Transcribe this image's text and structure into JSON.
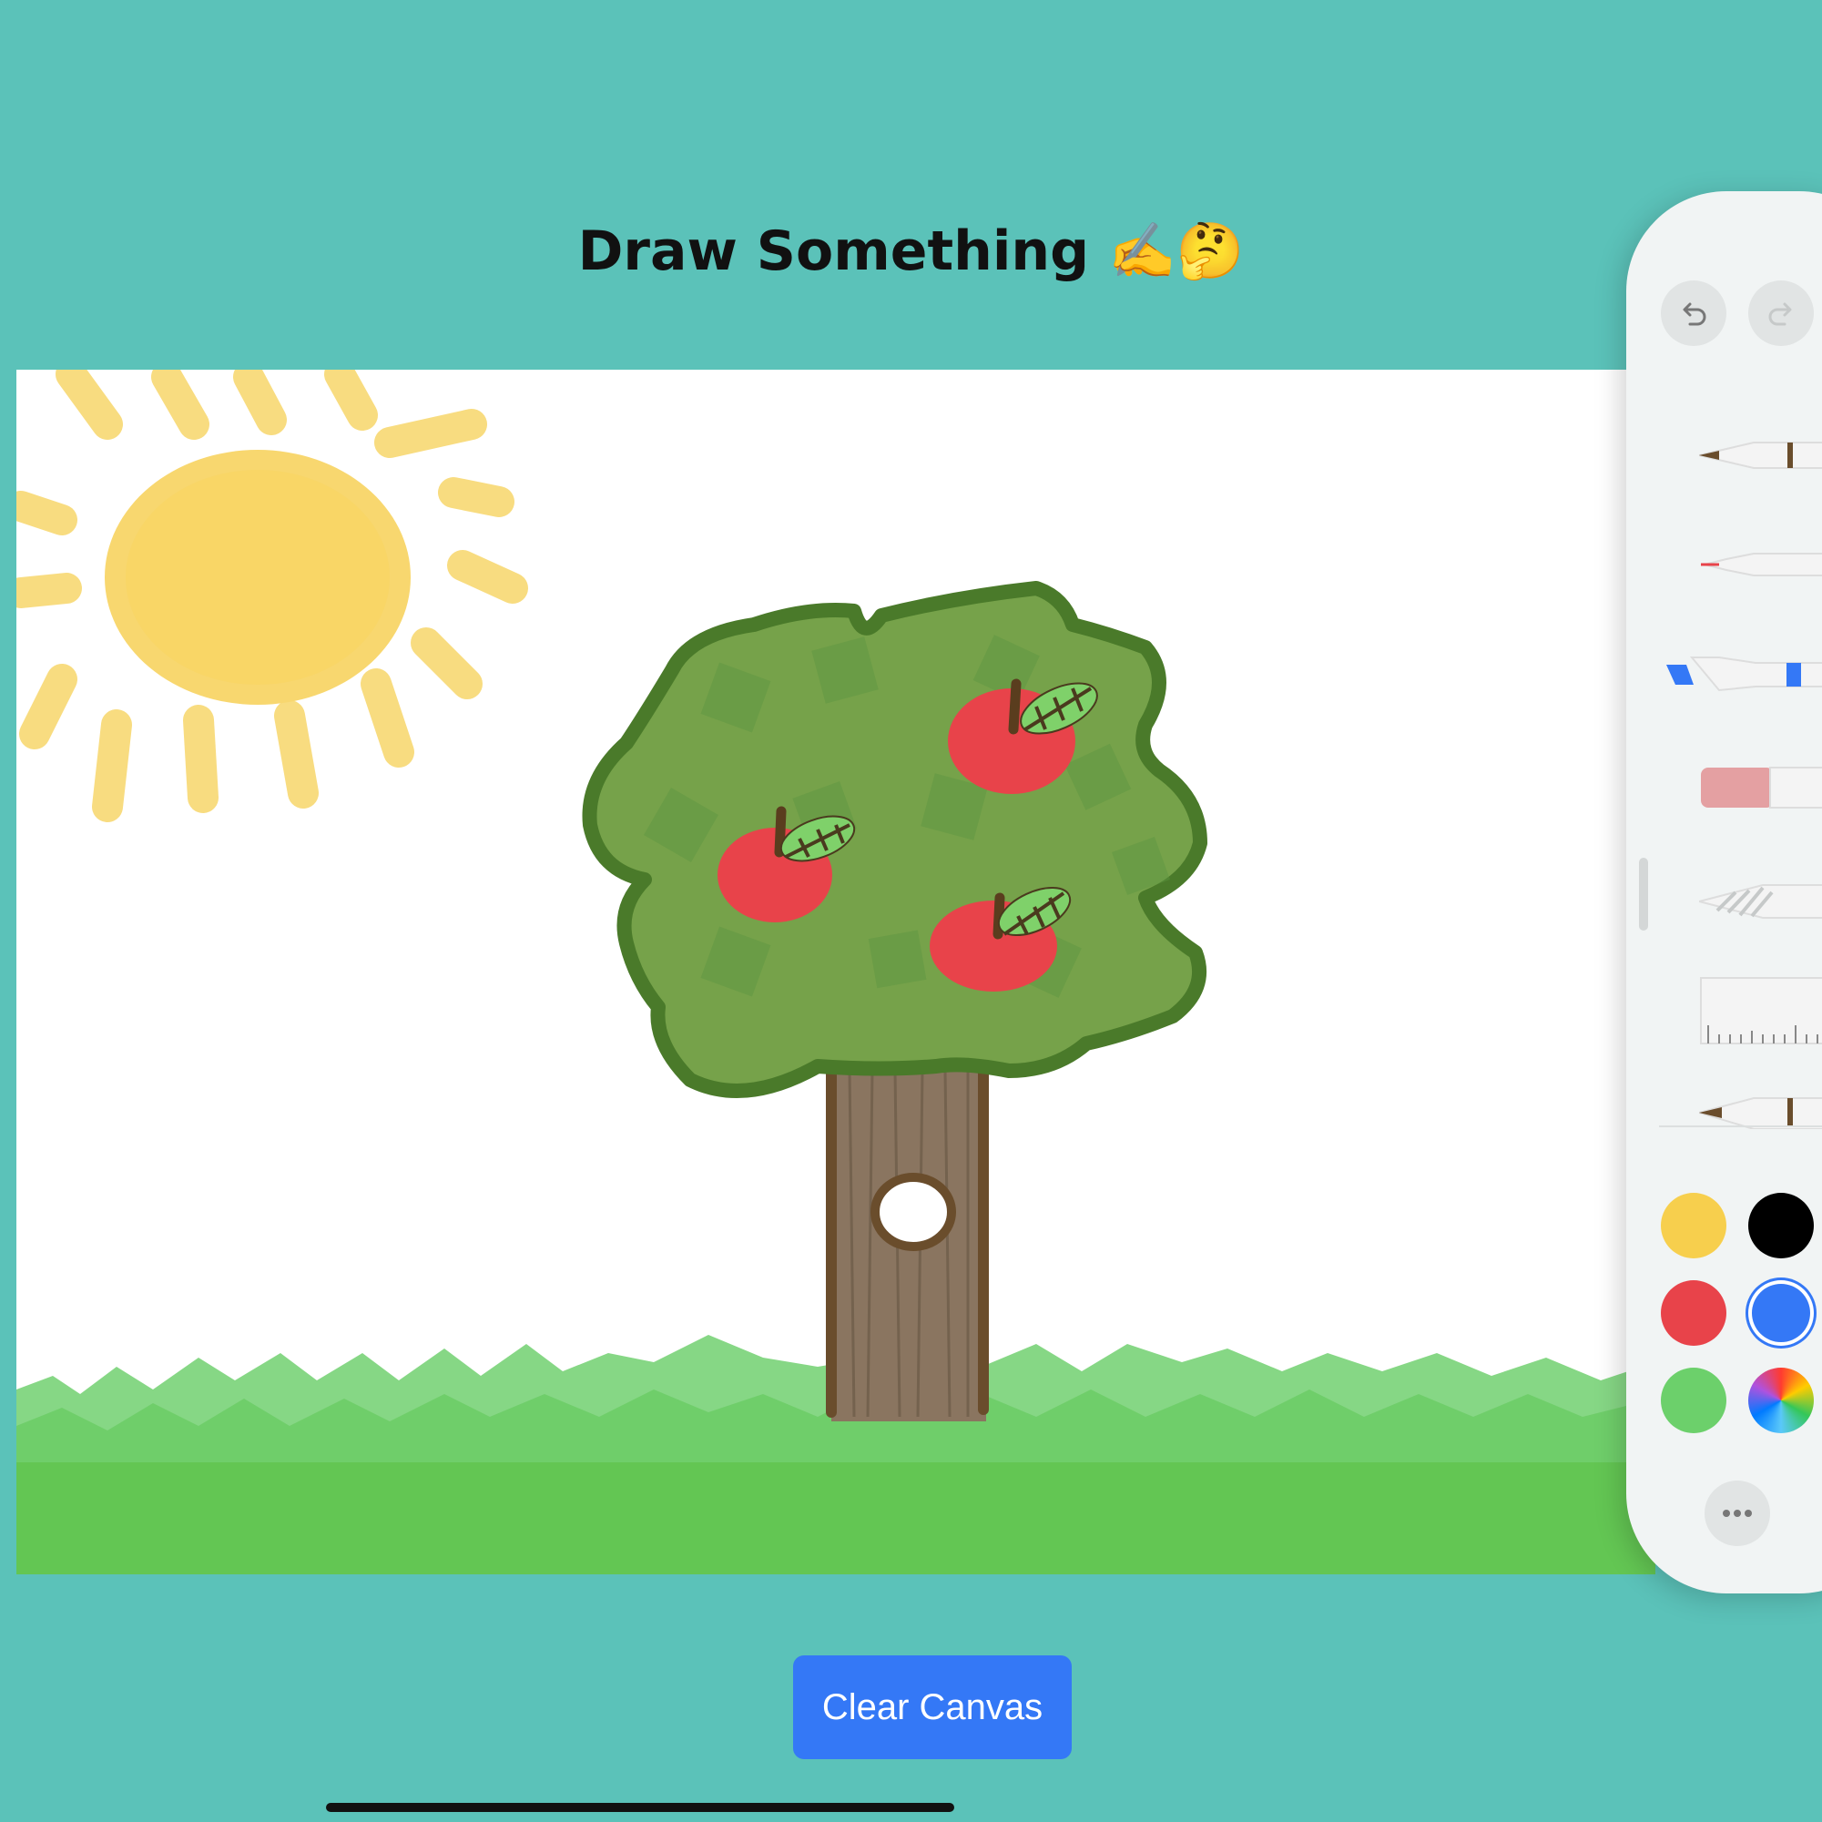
{
  "page": {
    "title": "Draw Something ✍️🤔",
    "background_color": "#5bc2b9"
  },
  "canvas": {
    "drawing_subjects": [
      "sun-icon",
      "apple-tree",
      "apple",
      "grass"
    ]
  },
  "actions": {
    "clear_label": "Clear Canvas"
  },
  "palette": {
    "buttons": [
      "undo-icon",
      "redo-icon",
      "more-icon"
    ],
    "tools": [
      "pen",
      "monoline",
      "marker",
      "eraser",
      "lasso",
      "ruler",
      "pencil"
    ],
    "colors": [
      {
        "name": "yellow",
        "hex": "#f7cf4d"
      },
      {
        "name": "black",
        "hex": "#000000"
      },
      {
        "name": "red",
        "hex": "#e8434a"
      },
      {
        "name": "blue",
        "hex": "#3478f6",
        "selected": true
      },
      {
        "name": "green",
        "hex": "#6cd06b"
      },
      {
        "name": "multicolor",
        "hex": "conic"
      }
    ]
  }
}
